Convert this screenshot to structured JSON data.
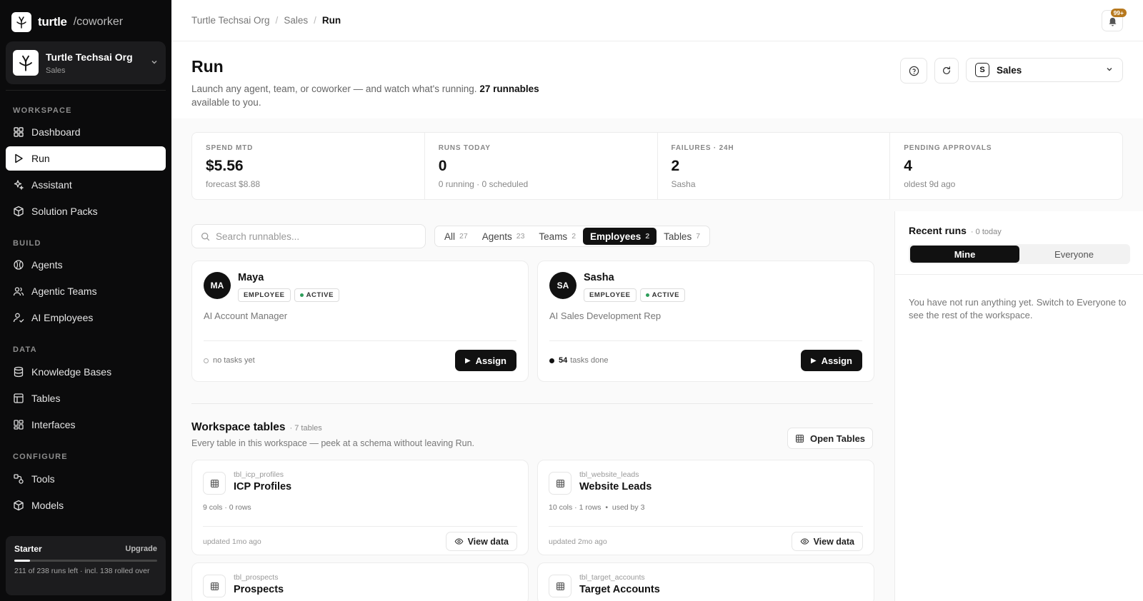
{
  "brand": {
    "name": "turtle",
    "suffix": "/coworker"
  },
  "org": {
    "name": "Turtle Techsai Org",
    "workspace": "Sales"
  },
  "sidebar": {
    "sections": {
      "workspace": "WORKSPACE",
      "build": "BUILD",
      "data": "DATA",
      "configure": "CONFIGURE"
    },
    "items": {
      "dashboard": "Dashboard",
      "run": "Run",
      "assistant": "Assistant",
      "solution_packs": "Solution Packs",
      "agents": "Agents",
      "agentic_teams": "Agentic Teams",
      "ai_employees": "AI Employees",
      "knowledge_bases": "Knowledge Bases",
      "tables": "Tables",
      "interfaces": "Interfaces",
      "tools": "Tools",
      "models": "Models"
    },
    "plan": {
      "name": "Starter",
      "upgrade": "Upgrade",
      "usage_text": "211 of 238 runs left · incl. 138 rolled over",
      "progress": 0.11
    }
  },
  "breadcrumb": {
    "items": [
      "Turtle Techsai Org",
      "Sales",
      "Run"
    ]
  },
  "notifications": {
    "badge": "99+"
  },
  "header": {
    "title": "Run",
    "description": "Launch any agent, team, or coworker — and watch what's running.",
    "count_bold": "27 runnables",
    "description_tail": "available to you."
  },
  "workspace_select": {
    "badge": "S",
    "label": "Sales"
  },
  "stats": [
    {
      "label": "SPEND MTD",
      "value": "$5.56",
      "sub": "forecast $8.88"
    },
    {
      "label": "RUNS TODAY",
      "value": "0",
      "sub": "0 running · 0 scheduled"
    },
    {
      "label": "FAILURES · 24H",
      "value": "2",
      "sub": "Sasha"
    },
    {
      "label": "PENDING APPROVALS",
      "value": "4",
      "sub": "oldest 9d ago"
    }
  ],
  "search": {
    "placeholder": "Search runnables..."
  },
  "filter_tabs": [
    {
      "label": "All",
      "count": "27"
    },
    {
      "label": "Agents",
      "count": "23"
    },
    {
      "label": "Teams",
      "count": "2"
    },
    {
      "label": "Employees",
      "count": "2"
    },
    {
      "label": "Tables",
      "count": "7"
    }
  ],
  "employees": [
    {
      "initials": "MA",
      "name": "Maya",
      "type_badge": "EMPLOYEE",
      "status_badge": "ACTIVE",
      "role": "AI Account Manager",
      "tasks_count": "",
      "tasks_text": "no tasks yet",
      "assign_label": "Assign"
    },
    {
      "initials": "SA",
      "name": "Sasha",
      "type_badge": "EMPLOYEE",
      "status_badge": "ACTIVE",
      "role": "AI Sales Development Rep",
      "tasks_count": "54",
      "tasks_text": "tasks done",
      "assign_label": "Assign"
    }
  ],
  "workspace_tables": {
    "title": "Workspace tables",
    "count": "· 7 tables",
    "description": "Every table in this workspace — peek at a schema without leaving Run.",
    "open_label": "Open Tables",
    "tables": [
      {
        "id": "tbl_icp_profiles",
        "name": "ICP Profiles",
        "meta": "9 cols · 0 rows",
        "updated": "updated 1mo ago",
        "view_label": "View data"
      },
      {
        "id": "tbl_website_leads",
        "name": "Website Leads",
        "meta": "10 cols · 1 rows  •  used by 3",
        "updated": "updated 2mo ago",
        "view_label": "View data"
      },
      {
        "id": "tbl_prospects",
        "name": "Prospects",
        "meta": "",
        "updated": "",
        "view_label": ""
      },
      {
        "id": "tbl_target_accounts",
        "name": "Target Accounts",
        "meta": "",
        "updated": "",
        "view_label": ""
      }
    ]
  },
  "recent_runs": {
    "title": "Recent runs",
    "count": "· 0 today",
    "segments": [
      "Mine",
      "Everyone"
    ],
    "empty_text": "You have not run anything yet. Switch to Everyone to see the rest of the workspace."
  }
}
